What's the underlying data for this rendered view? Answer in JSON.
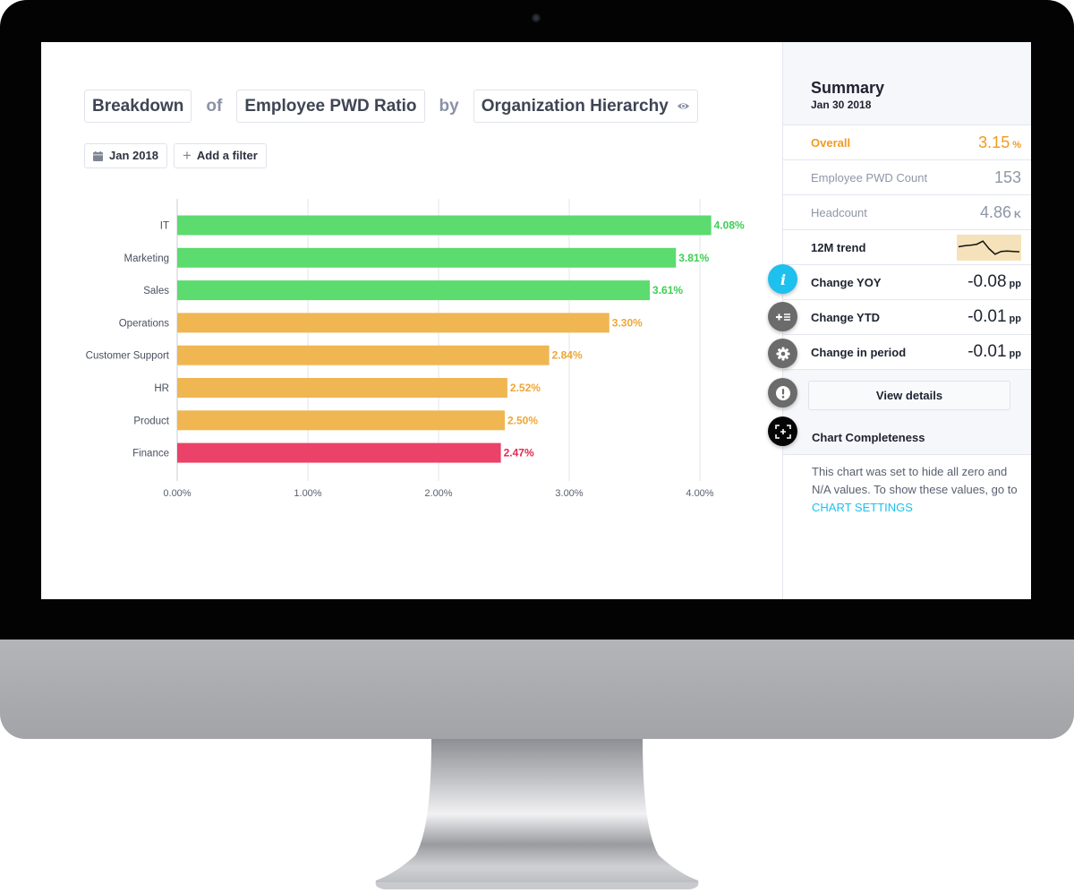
{
  "query": {
    "measure_type": "Breakdown",
    "connector_of": "of",
    "metric": "Employee PWD Ratio",
    "connector_by": "by",
    "dimension": "Organization Hierarchy",
    "dimension_icon": "eye-icon"
  },
  "filters": {
    "date": {
      "label": "Jan 2018",
      "icon": "calendar-icon"
    },
    "add_filter": {
      "label": "Add a filter",
      "icon": "plus-icon"
    }
  },
  "colors": {
    "green": "#5cdb6e",
    "orange": "#efb652",
    "red": "#ea4268",
    "green_text": "#3ccf52",
    "orange_text": "#efa634",
    "red_text": "#e7274f",
    "accent_blue": "#1ec0ee",
    "overall_orange": "#f29a1f"
  },
  "chart_data": {
    "type": "bar",
    "orientation": "horizontal",
    "title": "Breakdown of Employee PWD Ratio by Organization Hierarchy",
    "xlabel": "",
    "ylabel": "",
    "categories": [
      "IT",
      "Marketing",
      "Sales",
      "Operations",
      "Customer Support",
      "HR",
      "Product",
      "Finance"
    ],
    "values": [
      4.08,
      3.81,
      3.61,
      3.3,
      2.84,
      2.52,
      2.5,
      2.47
    ],
    "value_labels": [
      "4.08%",
      "3.81%",
      "3.61%",
      "3.30%",
      "2.84%",
      "2.52%",
      "2.50%",
      "2.47%"
    ],
    "bar_status": [
      "green",
      "green",
      "green",
      "orange",
      "orange",
      "orange",
      "orange",
      "red"
    ],
    "xlim": [
      0,
      4
    ],
    "xticks": [
      0,
      1,
      2,
      3,
      4
    ],
    "xtick_labels": [
      "0.00%",
      "1.00%",
      "2.00%",
      "3.00%",
      "4.00%"
    ],
    "grid": true,
    "legend": "none"
  },
  "summary": {
    "title": "Summary",
    "date": "Jan 30 2018",
    "overall": {
      "label": "Overall",
      "value": "3.15",
      "unit": "%"
    },
    "pwd_count": {
      "label": "Employee PWD Count",
      "value": "153"
    },
    "headcount": {
      "label": "Headcount",
      "value": "4.86",
      "unit": "K"
    },
    "trend": {
      "label": "12M trend",
      "sparkline": [
        0.55,
        0.6,
        0.63,
        0.68,
        0.85,
        0.45,
        0.15,
        0.3,
        0.32,
        0.3,
        0.28
      ]
    },
    "change_yoy": {
      "label": "Change YOY",
      "value": "-0.08",
      "unit": "pp"
    },
    "change_ytd": {
      "label": "Change YTD",
      "value": "-0.01",
      "unit": "pp"
    },
    "change_period": {
      "label": "Change in period",
      "value": "-0.01",
      "unit": "pp"
    },
    "view_details": "View details",
    "completeness": {
      "title": "Chart Completeness",
      "text": "This chart was set to hide all zero and N/A values. To show these values, go to ",
      "link": "CHART SETTINGS"
    }
  },
  "side_actions": [
    {
      "name": "info-icon",
      "color": "#1ec0ee"
    },
    {
      "name": "add-list-icon",
      "color": "#6b6b6b"
    },
    {
      "name": "gear-icon",
      "color": "#6b6b6b"
    },
    {
      "name": "alert-icon",
      "color": "#6b6b6b"
    },
    {
      "name": "expand-icon",
      "color": "#050505"
    }
  ]
}
